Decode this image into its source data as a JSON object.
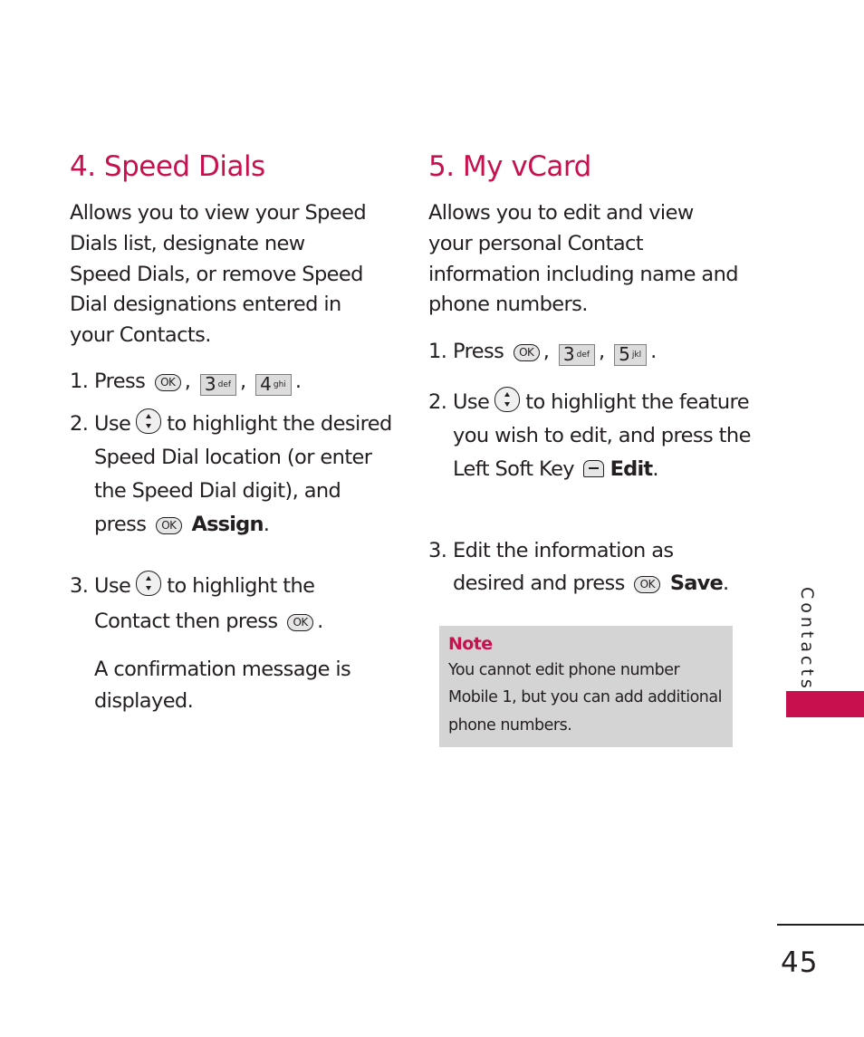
{
  "theme": {
    "accent": "#c8104f",
    "note_bg": "#d4d4d4",
    "text": "#231f20"
  },
  "speed_dials": {
    "title": "4. Speed Dials",
    "intro": "Allows you to view your Speed Dials list, designate new Speed Dials, or remove Speed Dial designations entered in your Contacts.",
    "steps": [
      {
        "num": "1.",
        "pre": "Press",
        "keys": [
          {
            "type": "ok-key",
            "label": "OK"
          },
          {
            "type": "num-key",
            "digit": "3",
            "letters": "def"
          },
          {
            "type": "num-key",
            "digit": "4",
            "letters": "ghi"
          }
        ]
      },
      {
        "num": "2.",
        "pre": "Use",
        "icon": "nav-key",
        "text": "to highlight the desired Speed Dial location (or enter the Speed Dial digit), and press",
        "ok_label": "OK",
        "bold": "Assign"
      },
      {
        "num": "3.",
        "pre": "Use",
        "icon": "nav-key",
        "text": "to highlight the Contact then press",
        "ok_label": "OK",
        "after": "A confirmation message is displayed."
      }
    ]
  },
  "my_vcard": {
    "title": "5. My vCard",
    "intro": "Allows you to edit and view your personal Contact information including name and phone numbers.",
    "steps": [
      {
        "num": "1.",
        "pre": "Press",
        "keys": [
          {
            "type": "ok-key",
            "label": "OK"
          },
          {
            "type": "num-key",
            "digit": "3",
            "letters": "def"
          },
          {
            "type": "num-key",
            "digit": "5",
            "letters": "jkl"
          }
        ]
      },
      {
        "num": "2.",
        "pre": "Use",
        "icon": "nav-key",
        "text": "to highlight the feature you wish to edit, and press the Left Soft Key",
        "soft_key": "left-soft-key",
        "bold": "Edit"
      },
      {
        "num": "3.",
        "text": "Edit the information as desired and press",
        "ok_label": "OK",
        "bold": "Save"
      }
    ],
    "note": {
      "title": "Note",
      "body": "You cannot edit phone number Mobile 1, but you can add additional phone numbers."
    }
  },
  "side_tab": {
    "label": "Contacts"
  },
  "page_number": "45"
}
